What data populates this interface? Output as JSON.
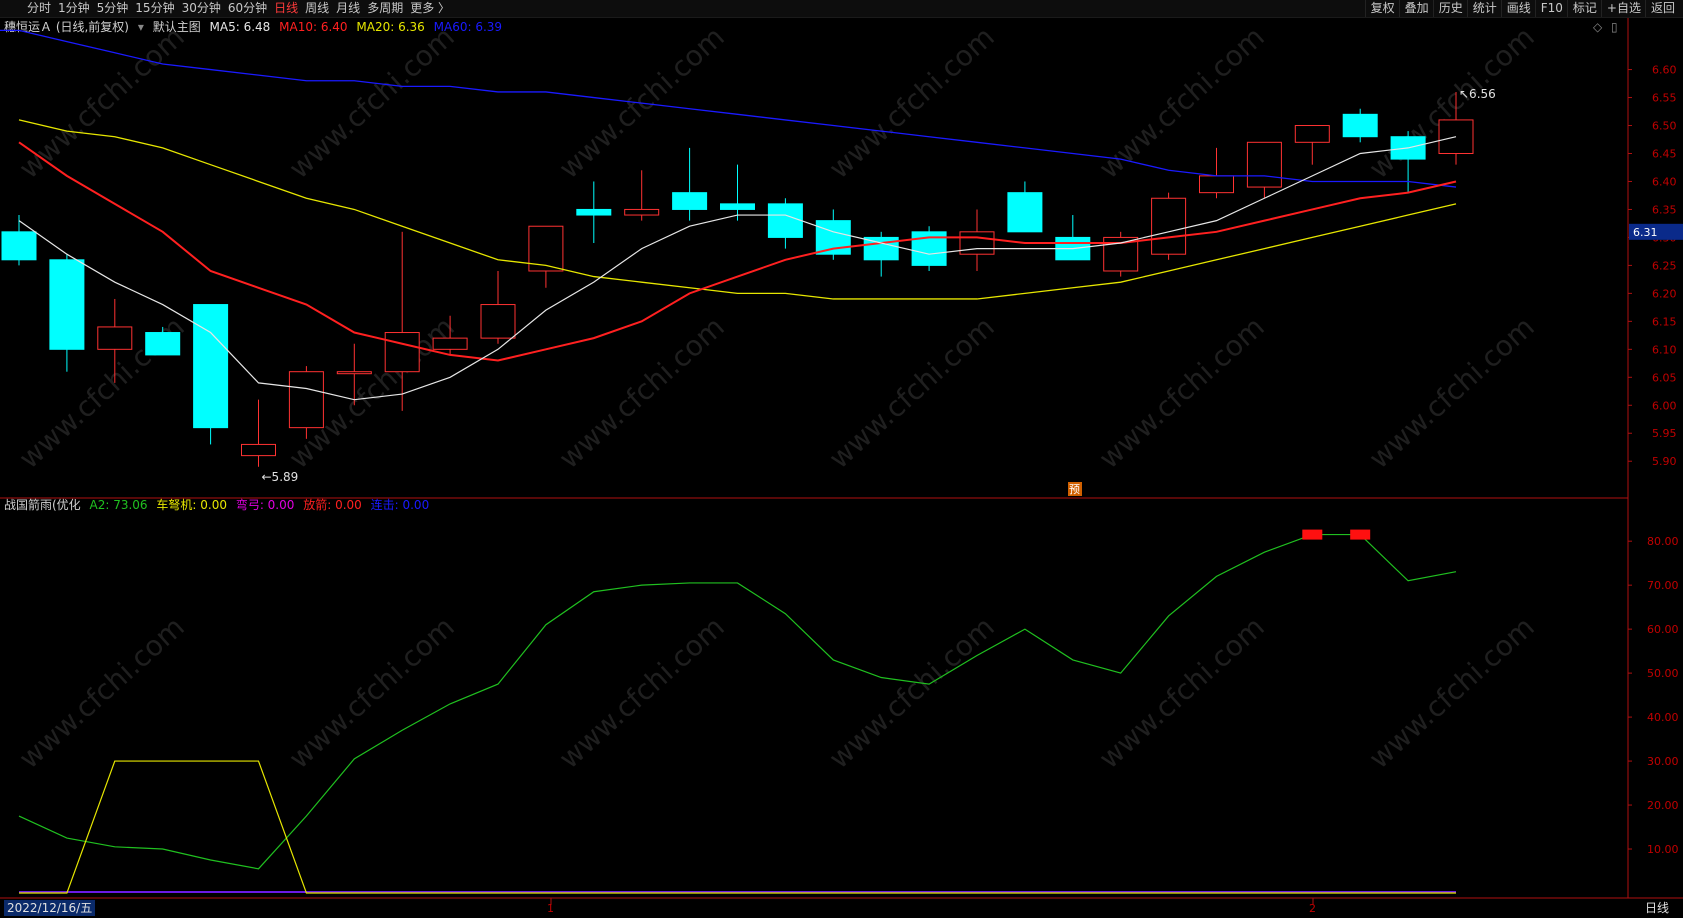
{
  "toolbar": {
    "timeframes": [
      "分时",
      "1分钟",
      "5分钟",
      "15分钟",
      "30分钟",
      "60分钟",
      "日线",
      "周线",
      "月线",
      "多周期",
      "更多 〉"
    ],
    "active_timeframe": "日线",
    "tools": [
      "复权",
      "叠加",
      "历史",
      "统计",
      "画线",
      "F10",
      "标记",
      "+自选",
      "返回"
    ]
  },
  "main_header": {
    "stock": "穗恒运Ａ (日线,前复权)",
    "template": "默认主图",
    "ma5": "MA5: 6.48",
    "ma10": "MA10: 6.40",
    "ma20": "MA20: 6.36",
    "ma60": "MA60: 6.39"
  },
  "indicator_header": {
    "name": "战国箭雨(优化",
    "a2": "A2: 73.06",
    "chejian": "车弩机: 0.00",
    "wangong": "弯弓: 0.00",
    "fangjian": "放箭: 0.00",
    "lianji": "连击: 0.00"
  },
  "bottom": {
    "date": "2022/12/16/五",
    "period_label": "日线",
    "month_marks": [
      "1",
      "2"
    ]
  },
  "colors": {
    "up": "#ff3232",
    "down": "#00ffff",
    "ma5": "#e6e6e6",
    "ma10": "#ff2020",
    "ma20": "#e6e600",
    "ma60": "#1a1aff",
    "axis": "#b01010",
    "a2": "#20c020",
    "chejian": "#e6e600",
    "lianji": "#6a1ae6"
  },
  "chart_data": {
    "type": "candlestick",
    "price_axis": {
      "ticks": [
        "6.60",
        "6.55",
        "6.50",
        "6.45",
        "6.40",
        "6.35",
        "6.30",
        "6.25",
        "6.20",
        "6.15",
        "6.10",
        "6.05",
        "6.00",
        "5.95",
        "5.90"
      ],
      "ylim": [
        5.87,
        6.66
      ],
      "current_price": "6.31"
    },
    "candles": [
      [
        6.31,
        6.26,
        6.34,
        6.25
      ],
      [
        6.26,
        6.1,
        6.27,
        6.06
      ],
      [
        6.1,
        6.14,
        6.19,
        6.04
      ],
      [
        6.13,
        6.09,
        6.14,
        6.09
      ],
      [
        6.18,
        5.96,
        6.18,
        5.93
      ],
      [
        5.91,
        5.93,
        6.01,
        5.89
      ],
      [
        5.96,
        6.06,
        6.07,
        5.94
      ],
      [
        6.06,
        6.06,
        6.11,
        6.0
      ],
      [
        6.06,
        6.13,
        6.31,
        5.99
      ],
      [
        6.1,
        6.12,
        6.16,
        6.09
      ],
      [
        6.12,
        6.18,
        6.24,
        6.11
      ],
      [
        6.24,
        6.32,
        6.32,
        6.21
      ],
      [
        6.35,
        6.34,
        6.4,
        6.29
      ],
      [
        6.34,
        6.35,
        6.42,
        6.33
      ],
      [
        6.38,
        6.35,
        6.46,
        6.33
      ],
      [
        6.36,
        6.35,
        6.43,
        6.33
      ],
      [
        6.36,
        6.3,
        6.37,
        6.28
      ],
      [
        6.33,
        6.27,
        6.35,
        6.26
      ],
      [
        6.3,
        6.26,
        6.31,
        6.23
      ],
      [
        6.31,
        6.25,
        6.32,
        6.24
      ],
      [
        6.27,
        6.31,
        6.35,
        6.24
      ],
      [
        6.38,
        6.31,
        6.4,
        6.31
      ],
      [
        6.3,
        6.26,
        6.34,
        6.26
      ],
      [
        6.24,
        6.3,
        6.31,
        6.23
      ],
      [
        6.27,
        6.37,
        6.38,
        6.26
      ],
      [
        6.38,
        6.41,
        6.46,
        6.37
      ],
      [
        6.39,
        6.47,
        6.47,
        6.37
      ],
      [
        6.47,
        6.5,
        6.5,
        6.43
      ],
      [
        6.52,
        6.48,
        6.53,
        6.47
      ],
      [
        6.48,
        6.44,
        6.49,
        6.38
      ],
      [
        6.45,
        6.51,
        6.56,
        6.43
      ]
    ],
    "high_label": "6.56",
    "low_label": "5.89",
    "forecast_marker": "预",
    "ma5": [
      6.33,
      6.27,
      6.22,
      6.18,
      6.13,
      6.04,
      6.03,
      6.01,
      6.02,
      6.05,
      6.1,
      6.17,
      6.22,
      6.28,
      6.32,
      6.34,
      6.34,
      6.31,
      6.29,
      6.27,
      6.28,
      6.28,
      6.28,
      6.29,
      6.31,
      6.33,
      6.37,
      6.41,
      6.45,
      6.46,
      6.48
    ],
    "ma10": [
      6.47,
      6.41,
      6.36,
      6.31,
      6.24,
      6.21,
      6.18,
      6.13,
      6.11,
      6.09,
      6.08,
      6.1,
      6.12,
      6.15,
      6.2,
      6.23,
      6.26,
      6.28,
      6.29,
      6.3,
      6.3,
      6.29,
      6.29,
      6.29,
      6.3,
      6.31,
      6.33,
      6.35,
      6.37,
      6.38,
      6.4
    ],
    "ma20": [
      6.51,
      6.49,
      6.48,
      6.46,
      6.43,
      6.4,
      6.37,
      6.35,
      6.32,
      6.29,
      6.26,
      6.25,
      6.23,
      6.22,
      6.21,
      6.2,
      6.2,
      6.19,
      6.19,
      6.19,
      6.19,
      6.2,
      6.21,
      6.22,
      6.24,
      6.26,
      6.28,
      6.3,
      6.32,
      6.34,
      6.36
    ],
    "ma60": [
      6.67,
      6.65,
      6.63,
      6.61,
      6.6,
      6.59,
      6.58,
      6.58,
      6.57,
      6.57,
      6.56,
      6.56,
      6.55,
      6.54,
      6.53,
      6.52,
      6.51,
      6.5,
      6.49,
      6.48,
      6.47,
      6.46,
      6.45,
      6.44,
      6.42,
      6.41,
      6.41,
      6.4,
      6.4,
      6.4,
      6.39
    ],
    "indicator": {
      "ticks": [
        "80.00",
        "70.00",
        "60.00",
        "50.00",
        "40.00",
        "30.00",
        "20.00",
        "10.00"
      ],
      "ylim": [
        0,
        88
      ],
      "a2": [
        17.5,
        12.5,
        10.5,
        10.0,
        7.5,
        5.5,
        17.5,
        30.5,
        37.0,
        43.0,
        47.5,
        61.0,
        68.5,
        70.0,
        70.5,
        70.5,
        63.5,
        53.0,
        49.0,
        47.5,
        54.0,
        60.0,
        53.0,
        50.0,
        63.0,
        72.0,
        77.5,
        81.5,
        81.5,
        71.0,
        73.06
      ],
      "chejian": [
        0,
        0,
        30,
        30,
        30,
        30,
        0,
        0,
        0,
        0,
        0,
        0,
        0,
        0,
        0,
        0,
        0,
        0,
        0,
        0,
        0,
        0,
        0,
        0,
        0,
        0,
        0,
        0,
        0,
        0,
        0
      ],
      "signals": [
        27,
        28
      ]
    }
  }
}
